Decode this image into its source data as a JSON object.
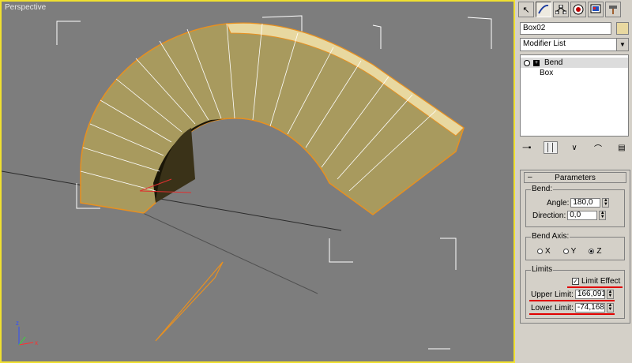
{
  "viewport": {
    "label": "Perspective",
    "border_color": "#f0e030",
    "background": "#7d7d7d",
    "object_color": "#b9a868",
    "object_top_color": "#e8d8a0",
    "selection_color": "#e89020"
  },
  "command_panel": {
    "tabs": [
      {
        "name": "create-tab",
        "icon": "cursor-icon"
      },
      {
        "name": "modify-tab",
        "icon": "curve-icon"
      },
      {
        "name": "hierarchy-tab",
        "icon": "hierarchy-icon"
      },
      {
        "name": "motion-tab",
        "icon": "motion-icon"
      },
      {
        "name": "display-tab",
        "icon": "display-icon"
      },
      {
        "name": "utilities-tab",
        "icon": "hammer-icon"
      }
    ],
    "object_name": "Box02",
    "object_color": "#e8d8a0",
    "modifier_list_label": "Modifier List",
    "stack": [
      {
        "label": "Bend",
        "selected": true
      },
      {
        "label": "Box",
        "selected": false
      }
    ]
  },
  "parameters": {
    "title": "Parameters",
    "bend": {
      "group_label": "Bend:",
      "angle_label": "Angle:",
      "angle_value": "180,0",
      "direction_label": "Direction:",
      "direction_value": "0,0"
    },
    "bend_axis": {
      "group_label": "Bend Axis:",
      "options": [
        "X",
        "Y",
        "Z"
      ],
      "selected": "Z"
    },
    "limits": {
      "group_label": "Limits",
      "limit_effect_label": "Limit Effect",
      "limit_effect_checked": true,
      "upper_label": "Upper Limit:",
      "upper_value": "166,091cm",
      "lower_label": "Lower Limit:",
      "lower_value": "-74,168cm",
      "highlight_color": "#e00000"
    }
  }
}
